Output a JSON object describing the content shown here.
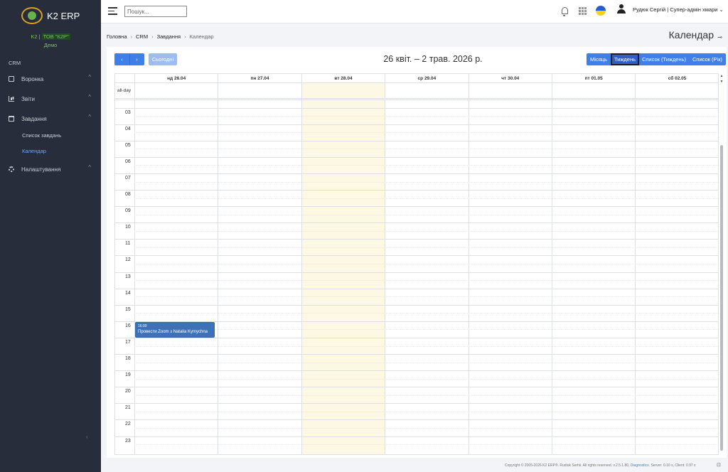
{
  "app": {
    "name": "K2 ERP",
    "company_code": "K2",
    "company_name": "ТОВ \"К2Р\"",
    "company_sep": "|",
    "mode": "Демо"
  },
  "sidebar": {
    "section": "CRM",
    "items": [
      {
        "label": "Воронка"
      },
      {
        "label": "Звіти"
      },
      {
        "label": "Завдання"
      },
      {
        "label": "Налаштування"
      }
    ],
    "subitems": [
      {
        "label": "Список завдань"
      },
      {
        "label": "Календар"
      }
    ],
    "collapse": "‹"
  },
  "topbar": {
    "search_placeholder": "Пошук...",
    "user": "Рудюк Сергій | Супер-адмін хмари"
  },
  "breadcrumb": {
    "items": [
      "Головна",
      "CRM",
      "Завдання"
    ],
    "current": "Календар",
    "sep": "›"
  },
  "page": {
    "title": "Календар"
  },
  "calendar": {
    "title": "26 квіт. – 2 трав. 2026 р.",
    "prev": "‹",
    "next": "›",
    "today": "Сьогодні",
    "views": {
      "month": "Місяць",
      "week": "Тиждень",
      "list_week": "Список (Тиждень)",
      "list_year": "Список (Рік)"
    },
    "allday_label": "all-day",
    "days": [
      "нд 26.04",
      "пн 27.04",
      "вт 28.04",
      "ср 29.04",
      "чт 30.04",
      "пт 01.05",
      "сб 02.05"
    ],
    "today_index": 2,
    "hours": [
      "03",
      "04",
      "05",
      "06",
      "07",
      "08",
      "09",
      "10",
      "11",
      "12",
      "13",
      "14",
      "15",
      "16",
      "17",
      "18",
      "19",
      "20",
      "21",
      "22",
      "23"
    ],
    "events": [
      {
        "time": "16:00",
        "title": "Провести Zoom з Natalia Kymychna",
        "day_index": 0,
        "start_hour": 16.0
      }
    ]
  },
  "footer": {
    "copyright": "Copyright © 2005-2026 K2 ERP®. Rudiuk Serhii. All rights reserved. v.2.5.1.80,",
    "diagnostics": "Diagnostics",
    "timing": ". Server: 0.10 s, Client: 0.97 s"
  },
  "colors": {
    "primary": "#3f7fe8",
    "sidebar_bg": "#272d3b",
    "today_bg": "#fcf8e3",
    "event_bg": "#3e72b8"
  }
}
